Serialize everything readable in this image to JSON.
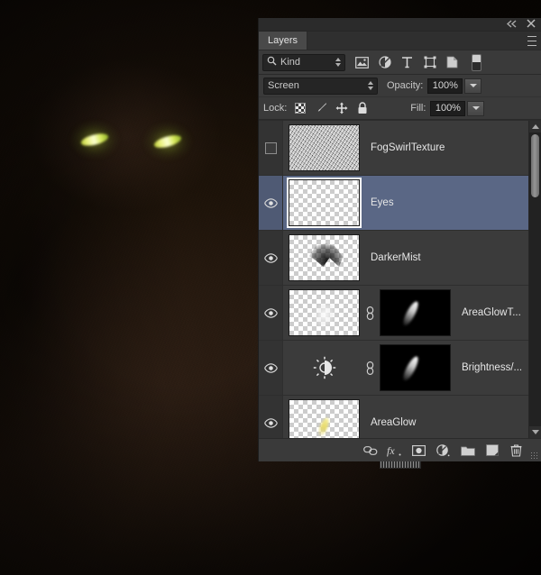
{
  "app": {
    "panel_title": "Layers"
  },
  "titlebar": {
    "collapse_icon": "collapse-double-arrow-icon",
    "close_icon": "close-icon"
  },
  "filter_bar": {
    "kind_label": "Kind",
    "search_icon": "search-icon",
    "icons": [
      {
        "name": "filter-pixel-layers-icon",
        "title": "Pixel layers"
      },
      {
        "name": "filter-adjustment-layers-icon",
        "title": "Adjustment layers"
      },
      {
        "name": "filter-type-layers-icon",
        "title": "Type layers"
      },
      {
        "name": "filter-shape-layers-icon",
        "title": "Shape layers"
      },
      {
        "name": "filter-smart-object-icon",
        "title": "Smart objects"
      }
    ],
    "toggle_name": "filter-enable-toggle"
  },
  "blend_bar": {
    "blend_mode": "Screen",
    "opacity_label": "Opacity:",
    "opacity_value": "100%"
  },
  "lock_bar": {
    "lock_label": "Lock:",
    "lock_icons": [
      {
        "name": "lock-transparent-pixels-icon"
      },
      {
        "name": "lock-image-pixels-icon"
      },
      {
        "name": "lock-position-icon"
      },
      {
        "name": "lock-all-icon"
      }
    ],
    "fill_label": "Fill:",
    "fill_value": "100%"
  },
  "layers": [
    {
      "name": "FogSwirlTexture",
      "visible": false,
      "selected": false,
      "thumb": "noise",
      "has_mask": false,
      "linked": false
    },
    {
      "name": "Eyes",
      "visible": true,
      "selected": true,
      "thumb": "empty",
      "has_mask": false,
      "linked": false
    },
    {
      "name": "DarkerMist",
      "visible": true,
      "selected": false,
      "thumb": "mist",
      "has_mask": false,
      "linked": false
    },
    {
      "name": "AreaGlowT...",
      "visible": true,
      "selected": false,
      "thumb": "soft",
      "has_mask": true,
      "linked": true
    },
    {
      "name": "Brightness/...",
      "visible": true,
      "selected": false,
      "thumb": "brightness-adjustment-icon",
      "has_mask": true,
      "linked": true
    },
    {
      "name": "AreaGlow",
      "visible": true,
      "selected": false,
      "thumb": "glow",
      "has_mask": false,
      "linked": false
    }
  ],
  "bottom_toolbar": [
    {
      "name": "link-layers-button",
      "icon": "link-icon"
    },
    {
      "name": "layer-style-button",
      "icon": "fx-icon",
      "label": "fx"
    },
    {
      "name": "add-layer-mask-button",
      "icon": "mask-icon"
    },
    {
      "name": "new-adjustment-layer-button",
      "icon": "adjustment-circle-icon"
    },
    {
      "name": "new-group-button",
      "icon": "folder-icon"
    },
    {
      "name": "new-layer-button",
      "icon": "new-layer-icon"
    },
    {
      "name": "delete-layer-button",
      "icon": "trash-icon"
    }
  ],
  "canvas": {
    "subject": "black-cat-glowing-eyes-photo",
    "background_color": "#1a1009",
    "eye_color": "#e8f07a"
  }
}
